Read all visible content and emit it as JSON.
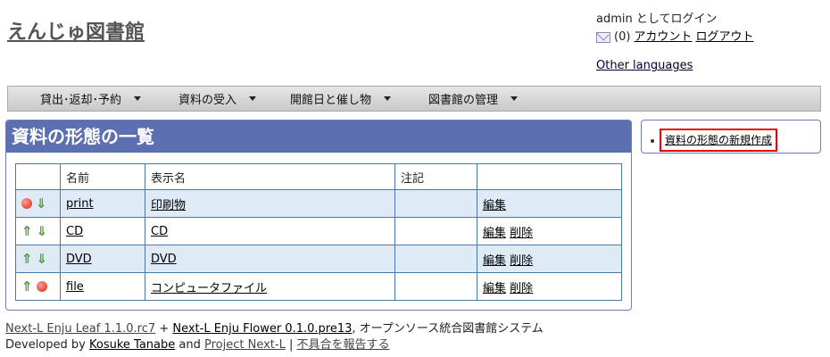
{
  "header": {
    "site_title": "えんじゅ図書館",
    "login_text": "admin としてログイン",
    "message_count": "(0)",
    "account_link": "アカウント",
    "logout_link": "ログアウト",
    "other_languages": "Other languages"
  },
  "menu": [
    {
      "label": "貸出･返却･予約"
    },
    {
      "label": "資料の受入"
    },
    {
      "label": "開館日と催し物"
    },
    {
      "label": "図書館の管理"
    }
  ],
  "main": {
    "title": "資料の形態の一覧",
    "columns": [
      "",
      "名前",
      "表示名",
      "注記",
      ""
    ],
    "rows": [
      {
        "name": "print",
        "display_name": "印刷物",
        "note": "",
        "edit": "編集",
        "delete": ""
      },
      {
        "name": "CD",
        "display_name": "CD",
        "note": "",
        "edit": "編集",
        "delete": "削除"
      },
      {
        "name": "DVD",
        "display_name": "DVD",
        "note": "",
        "edit": "編集",
        "delete": "削除"
      },
      {
        "name": "file",
        "display_name": "コンピュータファイル",
        "note": "",
        "edit": "編集",
        "delete": "削除"
      }
    ]
  },
  "side": {
    "new_link": "資料の形態の新規作成"
  },
  "footer": {
    "enju_leaf": "Next-L Enju Leaf 1.1.0.rc7",
    "plus": "+",
    "enju_flower": "Next-L Enju Flower 0.1.0.pre13",
    "desc": ", オープンソース統合図書館システム",
    "developed_by": "Developed by",
    "author": "Kosuke Tanabe",
    "and": "and",
    "project": "Project Next-L",
    "sep": "|",
    "report": "不具合を報告する"
  },
  "colors": {
    "panel_header": "#5b6fb1",
    "row_alt": "#dfeaf7",
    "highlight_border": "#ee0000"
  }
}
